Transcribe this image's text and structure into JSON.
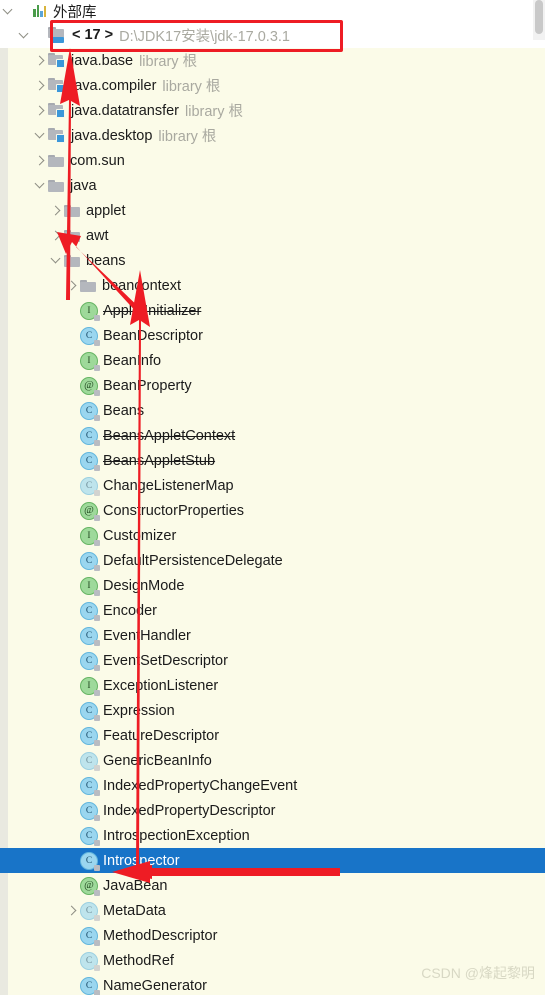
{
  "window": {
    "title": "External Libraries",
    "watermark": "CSDN @烽起黎明"
  },
  "root": {
    "label": "外部库",
    "icon": "bar-chart-icon",
    "expanded": true
  },
  "sdk": {
    "version_label": "< 17 >",
    "path": "D:\\JDK17安装\\jdk-17.0.3.1",
    "icon": "sdk-folder-icon",
    "expanded": true,
    "highlight_color": "#ee1c24"
  },
  "modules": [
    {
      "name": "java.base",
      "suffix": "library 根",
      "expanded": false
    },
    {
      "name": "java.compiler",
      "suffix": "library 根",
      "expanded": false
    },
    {
      "name": "java.datatransfer",
      "suffix": "library 根",
      "expanded": false
    },
    {
      "name": "java.desktop",
      "suffix": "library 根",
      "expanded": true
    }
  ],
  "packages": [
    {
      "name": "com.sun",
      "indent": 2,
      "expanded": false
    },
    {
      "name": "java",
      "indent": 2,
      "expanded": true
    },
    {
      "name": "applet",
      "indent": 3,
      "expanded": false
    },
    {
      "name": "awt",
      "indent": 3,
      "expanded": false
    },
    {
      "name": "beans",
      "indent": 3,
      "expanded": true
    },
    {
      "name": "beancontext",
      "indent": 4,
      "expanded": false
    }
  ],
  "types": [
    {
      "name": "AppletInitializer",
      "kind": "interface",
      "deprecated": true,
      "faded": false,
      "expandable": false
    },
    {
      "name": "BeanDescriptor",
      "kind": "class",
      "deprecated": false,
      "faded": false,
      "expandable": false
    },
    {
      "name": "BeanInfo",
      "kind": "interface",
      "deprecated": false,
      "faded": false,
      "expandable": false
    },
    {
      "name": "BeanProperty",
      "kind": "annotation",
      "deprecated": false,
      "faded": false,
      "expandable": false
    },
    {
      "name": "Beans",
      "kind": "class",
      "deprecated": false,
      "faded": false,
      "expandable": false
    },
    {
      "name": "BeansAppletContext",
      "kind": "class",
      "deprecated": true,
      "faded": false,
      "expandable": false
    },
    {
      "name": "BeansAppletStub",
      "kind": "class",
      "deprecated": true,
      "faded": false,
      "expandable": false
    },
    {
      "name": "ChangeListenerMap",
      "kind": "class",
      "deprecated": false,
      "faded": true,
      "expandable": false
    },
    {
      "name": "ConstructorProperties",
      "kind": "annotation",
      "deprecated": false,
      "faded": false,
      "expandable": false
    },
    {
      "name": "Customizer",
      "kind": "interface",
      "deprecated": false,
      "faded": false,
      "expandable": false
    },
    {
      "name": "DefaultPersistenceDelegate",
      "kind": "class",
      "deprecated": false,
      "faded": false,
      "expandable": false
    },
    {
      "name": "DesignMode",
      "kind": "interface",
      "deprecated": false,
      "faded": false,
      "expandable": false
    },
    {
      "name": "Encoder",
      "kind": "class",
      "deprecated": false,
      "faded": false,
      "expandable": false
    },
    {
      "name": "EventHandler",
      "kind": "class",
      "deprecated": false,
      "faded": false,
      "expandable": false
    },
    {
      "name": "EventSetDescriptor",
      "kind": "class",
      "deprecated": false,
      "faded": false,
      "expandable": false
    },
    {
      "name": "ExceptionListener",
      "kind": "interface",
      "deprecated": false,
      "faded": false,
      "expandable": false
    },
    {
      "name": "Expression",
      "kind": "class",
      "deprecated": false,
      "faded": false,
      "expandable": false
    },
    {
      "name": "FeatureDescriptor",
      "kind": "class",
      "deprecated": false,
      "faded": false,
      "expandable": false
    },
    {
      "name": "GenericBeanInfo",
      "kind": "class",
      "deprecated": false,
      "faded": true,
      "expandable": false
    },
    {
      "name": "IndexedPropertyChangeEvent",
      "kind": "class",
      "deprecated": false,
      "faded": false,
      "expandable": false
    },
    {
      "name": "IndexedPropertyDescriptor",
      "kind": "class",
      "deprecated": false,
      "faded": false,
      "expandable": false
    },
    {
      "name": "IntrospectionException",
      "kind": "class",
      "deprecated": false,
      "faded": false,
      "expandable": false
    },
    {
      "name": "Introspector",
      "kind": "class",
      "deprecated": false,
      "faded": false,
      "expandable": false,
      "selected": true
    },
    {
      "name": "JavaBean",
      "kind": "annotation",
      "deprecated": false,
      "faded": false,
      "expandable": false
    },
    {
      "name": "MetaData",
      "kind": "class",
      "deprecated": false,
      "faded": true,
      "expandable": true
    },
    {
      "name": "MethodDescriptor",
      "kind": "class",
      "deprecated": false,
      "faded": false,
      "expandable": false
    },
    {
      "name": "MethodRef",
      "kind": "class",
      "deprecated": false,
      "faded": true,
      "expandable": false
    },
    {
      "name": "NameGenerator",
      "kind": "class",
      "deprecated": false,
      "faded": false,
      "expandable": false
    }
  ],
  "selection": {
    "name": "Introspector",
    "background": "#1874c8",
    "text_color": "#ffffff"
  },
  "annotations": {
    "arrow_color": "#ee1c24",
    "arrow_1": "points up to the SDK path row",
    "arrow_2": "points up-left toward the java.desktop module",
    "arrow_3": "points left into the selected Introspector row"
  }
}
